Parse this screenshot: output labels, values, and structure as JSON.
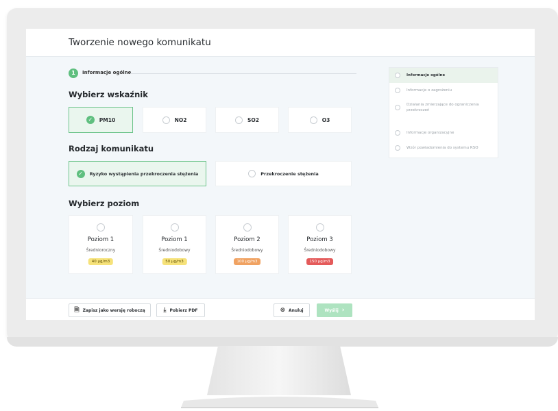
{
  "page_title": "Tworzenie nowego komunikatu",
  "step": {
    "number": "1",
    "label": "Informacje ogólne"
  },
  "indicator_section": {
    "title": "Wybierz wskaźnik",
    "options": [
      {
        "label": "PM10",
        "selected": true
      },
      {
        "label": "NO2",
        "selected": false
      },
      {
        "label": "SO2",
        "selected": false
      },
      {
        "label": "O3",
        "selected": false
      }
    ]
  },
  "message_type_section": {
    "title": "Rodzaj komunikatu",
    "options": [
      {
        "label": "Ryzyko wystąpienia przekroczenia stężenia",
        "selected": true
      },
      {
        "label": "Przekroczenie stężenia",
        "selected": false
      }
    ]
  },
  "level_section": {
    "title": "Wybierz poziom",
    "levels": [
      {
        "name": "Poziom 1",
        "sub": "Średnioroczny",
        "badge": "40 µg/m3",
        "badge_color": "#f6e27a"
      },
      {
        "name": "Poziom 1",
        "sub": "Średniodobowy",
        "badge": "50 µg/m3",
        "badge_color": "#f6e27a"
      },
      {
        "name": "Poziom 2",
        "sub": "Średniodobowy",
        "badge": "100 µg/m3",
        "badge_color": "#f0a262"
      },
      {
        "name": "Poziom 3",
        "sub": "Średniodobowy",
        "badge": "150 µg/m3",
        "badge_color": "#e45a5a"
      }
    ]
  },
  "sidebar": {
    "items": [
      {
        "label": "Informacje ogólne",
        "active": true
      },
      {
        "label": "Informacje o zagrożeniu",
        "active": false
      },
      {
        "label": "Działania zmierzające do ograniczenia przekroczeń",
        "active": false
      },
      {
        "label": "Informacje organizacyjne",
        "active": false
      },
      {
        "label": "Wzór powiadomienia do systemu RSO",
        "active": false
      }
    ]
  },
  "footer": {
    "save_draft": "Zapisz jako wersję roboczą",
    "download_pdf": "Pobierz PDF",
    "cancel": "Anuluj",
    "next": "Wyślij"
  },
  "colors": {
    "accent": "#5fbf7f",
    "selected_bg": "#eaf6ee",
    "disabled_primary": "#aee3c0"
  }
}
